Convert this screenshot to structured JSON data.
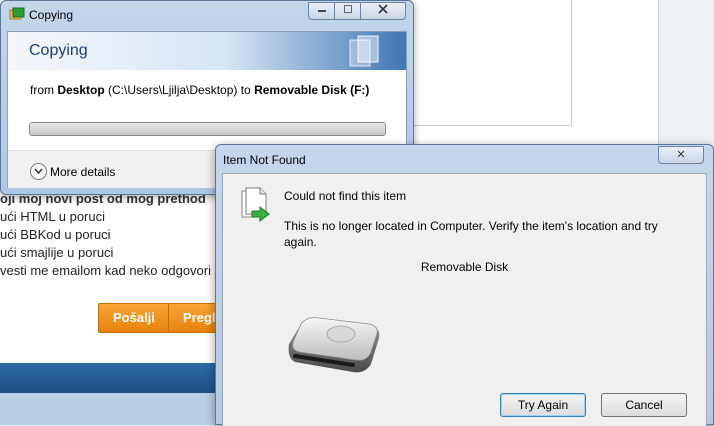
{
  "background_page": {
    "options": [
      "oji moj novi post od mog prethod",
      "ući HTML u poruci",
      "ući BBKod u poruci",
      "ući smajlije u poruci",
      "vesti me emailom kad neko odgovori"
    ],
    "send_button": "Pošalji",
    "preview_button": "Pregl"
  },
  "copy_dialog": {
    "title": "Copying",
    "heading": "Copying",
    "detail": {
      "prefix": "from ",
      "source_name": "Desktop",
      "source_path": " (C:\\Users\\Ljilja\\Desktop) to ",
      "destination": "Removable Disk (F:)"
    },
    "progress_percent": 0,
    "more_details": "More details"
  },
  "not_found_dialog": {
    "title": "Item Not Found",
    "close_symbol": "✕",
    "heading": "Could not find this item",
    "message": "This is no longer located in Computer. Verify the item's location and try again.",
    "item_name": "Removable Disk",
    "try_again_label": "Try Again",
    "cancel_label": "Cancel"
  },
  "icons": {
    "copy_title_icon": "folder-copy-icon",
    "more_details_icon": "chevron-down-icon",
    "file_icon": "file-arrow-icon",
    "disk_icon": "removable-disk-icon"
  },
  "colors": {
    "progress_fill": "#25a225",
    "accent_orange": "#e8820c",
    "title_blue": "#1e3f73"
  }
}
